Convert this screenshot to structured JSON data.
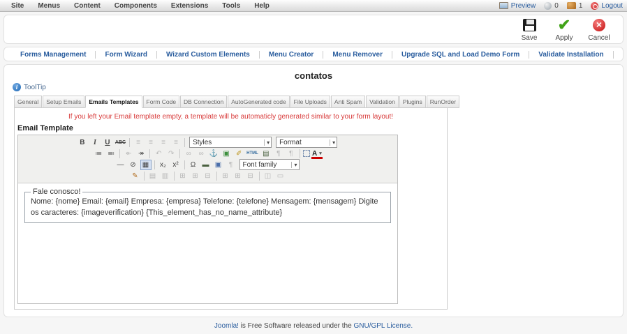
{
  "colors": {
    "link_blue": "#2a5d9e",
    "warning_red": "#d83a3a"
  },
  "menubar": {
    "items": [
      "Site",
      "Menus",
      "Content",
      "Components",
      "Extensions",
      "Tools",
      "Help"
    ],
    "status": {
      "preview_label": "Preview",
      "message_count": "0",
      "user_count": "1",
      "logout_label": "Logout"
    }
  },
  "toolbar": {
    "save_label": "Save",
    "apply_label": "Apply",
    "cancel_label": "Cancel"
  },
  "submenu": {
    "links": [
      "Forms Management",
      "Form Wizard",
      "Wizard Custom Elements",
      "Menu Creator",
      "Menu Remover",
      "Upgrade SQL and Load Demo Form",
      "Validate Installation"
    ]
  },
  "page": {
    "title": "contatos",
    "tooltip_label": "ToolTip"
  },
  "tabs": {
    "items": [
      "General",
      "Setup Emails",
      "Emails Templates",
      "Form Code",
      "DB Connection",
      "AutoGenerated code",
      "File Uploads",
      "Anti Spam",
      "Validation",
      "Plugins",
      "RunOrder"
    ],
    "active": "Emails Templates"
  },
  "form": {
    "warning": "If you left your Email template empty, a template will be automaticly generated similar to your form layout!",
    "field_label": "Email Template"
  },
  "editor": {
    "rows": [
      [
        {
          "k": "btn",
          "n": "bold-button",
          "g": "B",
          "c": "g-bold"
        },
        {
          "k": "btn",
          "n": "italic-button",
          "g": "I",
          "c": "g-italic"
        },
        {
          "k": "btn",
          "n": "underline-button",
          "g": "U",
          "c": "g-underline"
        },
        {
          "k": "btn",
          "n": "strikethrough-button",
          "g": "ABC",
          "c": "g-strike"
        },
        {
          "k": "sep"
        },
        {
          "k": "btn",
          "n": "align-left-button",
          "g": "≡",
          "c": "dis"
        },
        {
          "k": "btn",
          "n": "align-center-button",
          "g": "≡",
          "c": "dis"
        },
        {
          "k": "btn",
          "n": "align-right-button",
          "g": "≡",
          "c": "dis"
        },
        {
          "k": "btn",
          "n": "align-justify-button",
          "g": "≡",
          "c": "dis"
        },
        {
          "k": "sep"
        },
        {
          "k": "sel",
          "n": "styles-select",
          "label": "Styles"
        },
        {
          "k": "sel",
          "n": "format-select",
          "label": "Format"
        }
      ],
      [
        {
          "k": "btn",
          "n": "bullet-list-button",
          "g": "≔",
          "c": ""
        },
        {
          "k": "btn",
          "n": "numbered-list-button",
          "g": "≕",
          "c": ""
        },
        {
          "k": "sep"
        },
        {
          "k": "btn",
          "n": "outdent-button",
          "g": "↞",
          "c": "dis"
        },
        {
          "k": "btn",
          "n": "indent-button",
          "g": "↠",
          "c": ""
        },
        {
          "k": "sep"
        },
        {
          "k": "btn",
          "n": "undo-button",
          "g": "↶",
          "c": "dis"
        },
        {
          "k": "btn",
          "n": "redo-button",
          "g": "↷",
          "c": "dis"
        },
        {
          "k": "sep"
        },
        {
          "k": "btn",
          "n": "link-button",
          "g": "∞",
          "c": "dis"
        },
        {
          "k": "btn",
          "n": "unlink-button",
          "g": "∞",
          "c": "dis"
        },
        {
          "k": "btn",
          "n": "anchor-button",
          "g": "⚓",
          "c": "c-anchor"
        },
        {
          "k": "btn",
          "n": "image-button",
          "g": "▣",
          "c": "c-image"
        },
        {
          "k": "btn",
          "n": "cleanup-button",
          "g": "✐",
          "c": "c-clean"
        },
        {
          "k": "btn",
          "n": "html-source-button",
          "g": "HTML",
          "c": "c-html"
        },
        {
          "k": "btn",
          "n": "media-button",
          "g": "▤",
          "c": "c-media"
        },
        {
          "k": "btn",
          "n": "ltr-button",
          "g": "¶",
          "c": "dis"
        },
        {
          "k": "btn",
          "n": "rtl-button",
          "g": "¶",
          "c": "dis"
        },
        {
          "k": "sep"
        },
        {
          "k": "btn",
          "n": "visual-aid-button",
          "g": "",
          "c": "c-box"
        },
        {
          "k": "btn",
          "n": "text-color-button",
          "g": "A",
          "c": "c-fore"
        }
      ],
      [
        {
          "k": "btn",
          "n": "horizontal-rule-button",
          "g": "—",
          "c": ""
        },
        {
          "k": "btn",
          "n": "remove-format-button",
          "g": "⊘",
          "c": ""
        },
        {
          "k": "btn",
          "n": "table-guidelines-button",
          "g": "▦",
          "c": "sel-state"
        },
        {
          "k": "sep"
        },
        {
          "k": "btn",
          "n": "subscript-button",
          "g": "x₂",
          "c": ""
        },
        {
          "k": "btn",
          "n": "superscript-button",
          "g": "x²",
          "c": ""
        },
        {
          "k": "sep"
        },
        {
          "k": "btn",
          "n": "special-char-button",
          "g": "Ω",
          "c": ""
        },
        {
          "k": "btn",
          "n": "nonbreaking-button",
          "g": "▬",
          "c": "c-media"
        },
        {
          "k": "btn",
          "n": "iframe-button",
          "g": "▣",
          "c": "c-iframe"
        },
        {
          "k": "btn",
          "n": "attributes-button",
          "g": "¶",
          "c": "dis"
        },
        {
          "k": "sel",
          "n": "font-family-select",
          "label": "Font family"
        }
      ],
      [
        {
          "k": "btn",
          "n": "insert-table-button",
          "g": "✎",
          "c": "c-edit"
        },
        {
          "k": "sep"
        },
        {
          "k": "btn",
          "n": "table-row-props-button",
          "g": "▤",
          "c": "dis"
        },
        {
          "k": "btn",
          "n": "table-cell-props-button",
          "g": "▥",
          "c": "dis"
        },
        {
          "k": "sep"
        },
        {
          "k": "btn",
          "n": "insert-row-before-button",
          "g": "⊞",
          "c": "dis"
        },
        {
          "k": "btn",
          "n": "insert-row-after-button",
          "g": "⊞",
          "c": "dis"
        },
        {
          "k": "btn",
          "n": "delete-row-button",
          "g": "⊟",
          "c": "dis"
        },
        {
          "k": "sep"
        },
        {
          "k": "btn",
          "n": "insert-col-before-button",
          "g": "⊞",
          "c": "dis"
        },
        {
          "k": "btn",
          "n": "insert-col-after-button",
          "g": "⊞",
          "c": "dis"
        },
        {
          "k": "btn",
          "n": "delete-col-button",
          "g": "⊟",
          "c": "dis"
        },
        {
          "k": "sep"
        },
        {
          "k": "btn",
          "n": "split-cells-button",
          "g": "◫",
          "c": "dis"
        },
        {
          "k": "btn",
          "n": "merge-cells-button",
          "g": "▭",
          "c": "dis"
        }
      ]
    ],
    "content": {
      "legend": "Fale conosco!",
      "body": "Nome: {nome} Email: {email} Empresa: {empresa} Telefone: {telefone} Mensagem: {mensagem} Digite os caracteres: {imageverification} {This_element_has_no_name_attribute}"
    }
  },
  "footer": {
    "link1": "Joomla!",
    "text": " is Free Software released under the ",
    "link2": "GNU/GPL License."
  }
}
